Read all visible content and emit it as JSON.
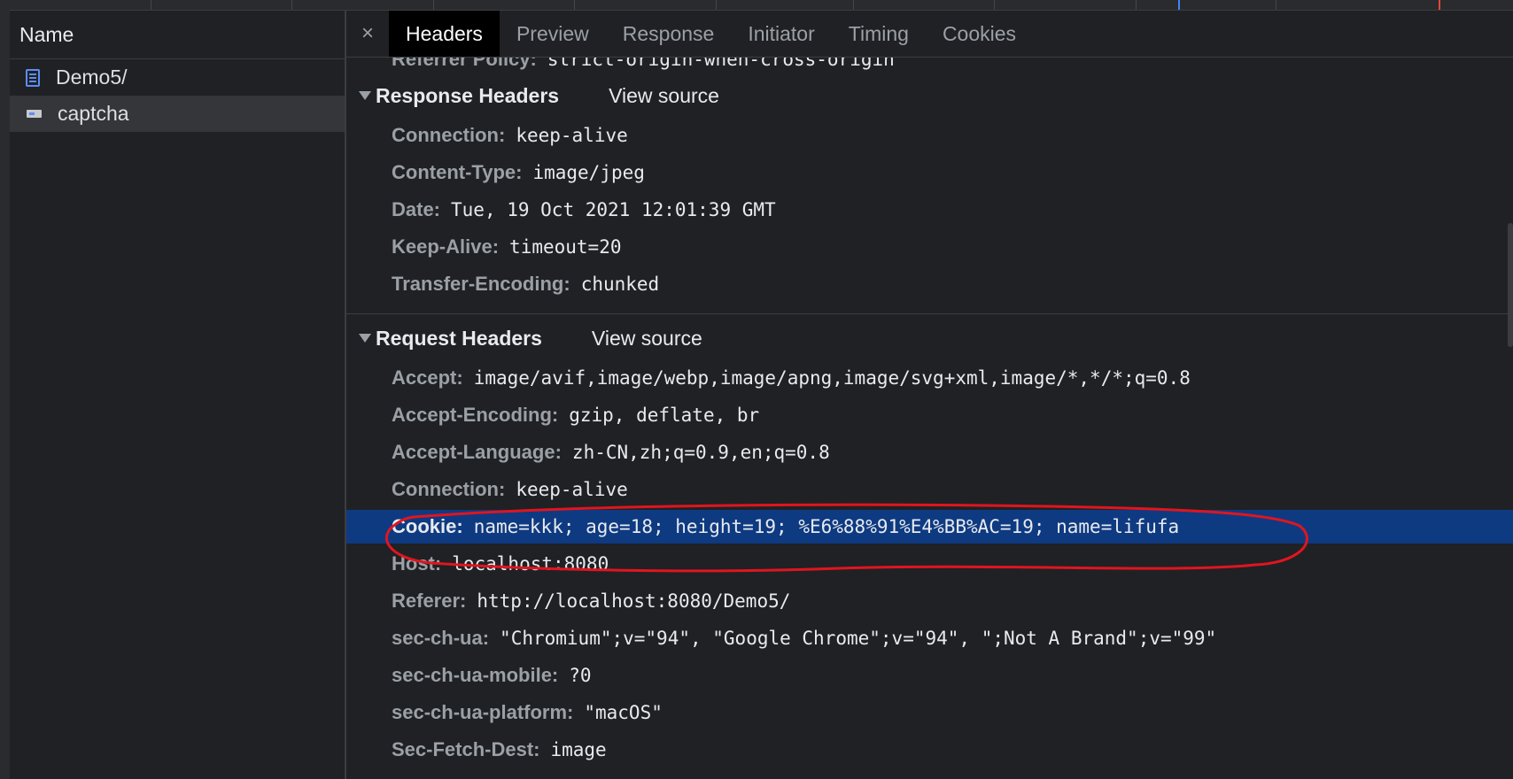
{
  "left_panel": {
    "header": "Name",
    "requests": [
      {
        "name": "Demo5/",
        "icon": "document-icon",
        "selected": false
      },
      {
        "name": "captcha",
        "icon": "image-icon",
        "selected": true
      }
    ]
  },
  "tabs": {
    "close": "×",
    "items": [
      "Headers",
      "Preview",
      "Response",
      "Initiator",
      "Timing",
      "Cookies"
    ],
    "active": "Headers"
  },
  "cut_row": {
    "name": "Referrer Policy:",
    "value": "strict-origin-when-cross-origin"
  },
  "response_headers": {
    "title": "Response Headers",
    "view_source": "View source",
    "rows": [
      {
        "name": "Connection:",
        "value": "keep-alive"
      },
      {
        "name": "Content-Type:",
        "value": "image/jpeg"
      },
      {
        "name": "Date:",
        "value": "Tue, 19 Oct 2021 12:01:39 GMT"
      },
      {
        "name": "Keep-Alive:",
        "value": "timeout=20"
      },
      {
        "name": "Transfer-Encoding:",
        "value": "chunked"
      }
    ]
  },
  "request_headers": {
    "title": "Request Headers",
    "view_source": "View source",
    "rows": [
      {
        "name": "Accept:",
        "value": "image/avif,image/webp,image/apng,image/svg+xml,image/*,*/*;q=0.8"
      },
      {
        "name": "Accept-Encoding:",
        "value": "gzip, deflate, br"
      },
      {
        "name": "Accept-Language:",
        "value": "zh-CN,zh;q=0.9,en;q=0.8"
      },
      {
        "name": "Connection:",
        "value": "keep-alive"
      },
      {
        "name": "Cookie:",
        "value": "name=kkk; age=18; height=19; %E6%88%91%E4%BB%AC=19; name=lifufa"
      },
      {
        "name": "Host:",
        "value": "localhost:8080"
      },
      {
        "name": "Referer:",
        "value": "http://localhost:8080/Demo5/"
      },
      {
        "name": "sec-ch-ua:",
        "value": "\"Chromium\";v=\"94\", \"Google Chrome\";v=\"94\", \";Not A Brand\";v=\"99\""
      },
      {
        "name": "sec-ch-ua-mobile:",
        "value": "?0"
      },
      {
        "name": "sec-ch-ua-platform:",
        "value": "\"macOS\""
      },
      {
        "name": "Sec-Fetch-Dest:",
        "value": "image"
      }
    ]
  },
  "colors": {
    "background": "#202124",
    "selection": "#0e3a82",
    "annotation": "#e0151f",
    "active_tab": "#000000"
  }
}
